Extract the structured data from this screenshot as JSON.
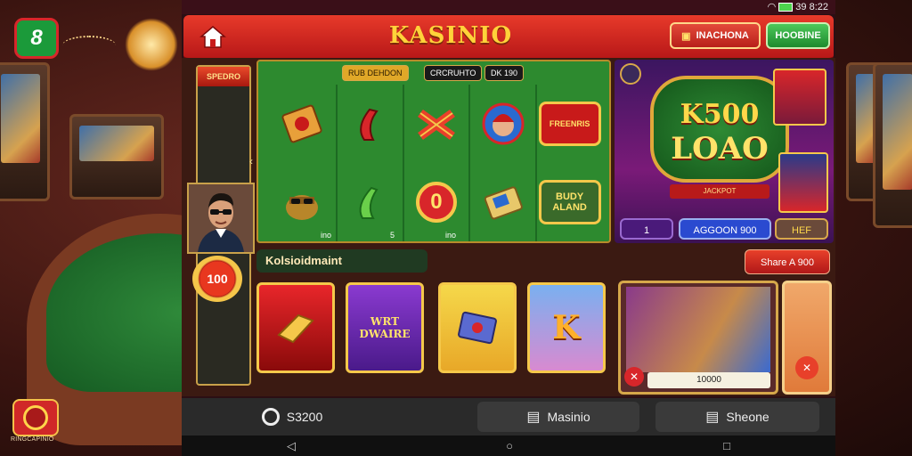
{
  "status_bar": {
    "time": "39 8:22"
  },
  "header": {
    "title": "KASINIO",
    "primary_button": "INACHONA",
    "secondary_button": "HOOBINE"
  },
  "left_column": {
    "tab_label": "SPEDRO",
    "coin_badge_value": "100"
  },
  "slots": {
    "chips": [
      "RUB DEHDON",
      "CRCRUHTO",
      "DK 190"
    ],
    "reel_symbols": [
      "card-icon",
      "horseshoe-icon",
      "ribbon-icon",
      "girl-avatar-icon",
      "bonus-sign-icon",
      "pot-icon",
      "horseshoe-icon",
      "zero-coin-icon",
      "card-box-icon",
      "busy-sign-icon"
    ],
    "reel_texts": [
      "",
      "",
      "",
      "",
      "FREENRIS",
      "",
      "",
      "0",
      "",
      "BUDY ALAND"
    ],
    "reel_labels": [
      "ino",
      "5",
      "ino"
    ]
  },
  "promo": {
    "line1": "K500",
    "line2": "LOAO",
    "ribbon": "JACKPOT",
    "btn_left": "1",
    "btn_mid": "AGGOON 900",
    "btn_right": "HEF"
  },
  "lower": {
    "subtitle": "Kolsioidmaint",
    "share_button": "Share A 900",
    "game_texts": [
      "",
      "WRT DWAIRE",
      "",
      "K"
    ],
    "feature_value": "10000"
  },
  "tabbar": {
    "tabs": [
      {
        "label": "S3200",
        "icon": "search-icon"
      },
      {
        "label": "Masinio",
        "icon": "slot-icon"
      },
      {
        "label": "Sheone",
        "icon": "slot-icon"
      }
    ]
  },
  "corner": {
    "caption": "RINGCAPINIO",
    "logo_text": "8"
  },
  "colors": {
    "header_red": "#d8262a",
    "felt_green": "#2d8a2f",
    "gold": "#f5c84a",
    "promo_purple": "#6a1a78"
  }
}
